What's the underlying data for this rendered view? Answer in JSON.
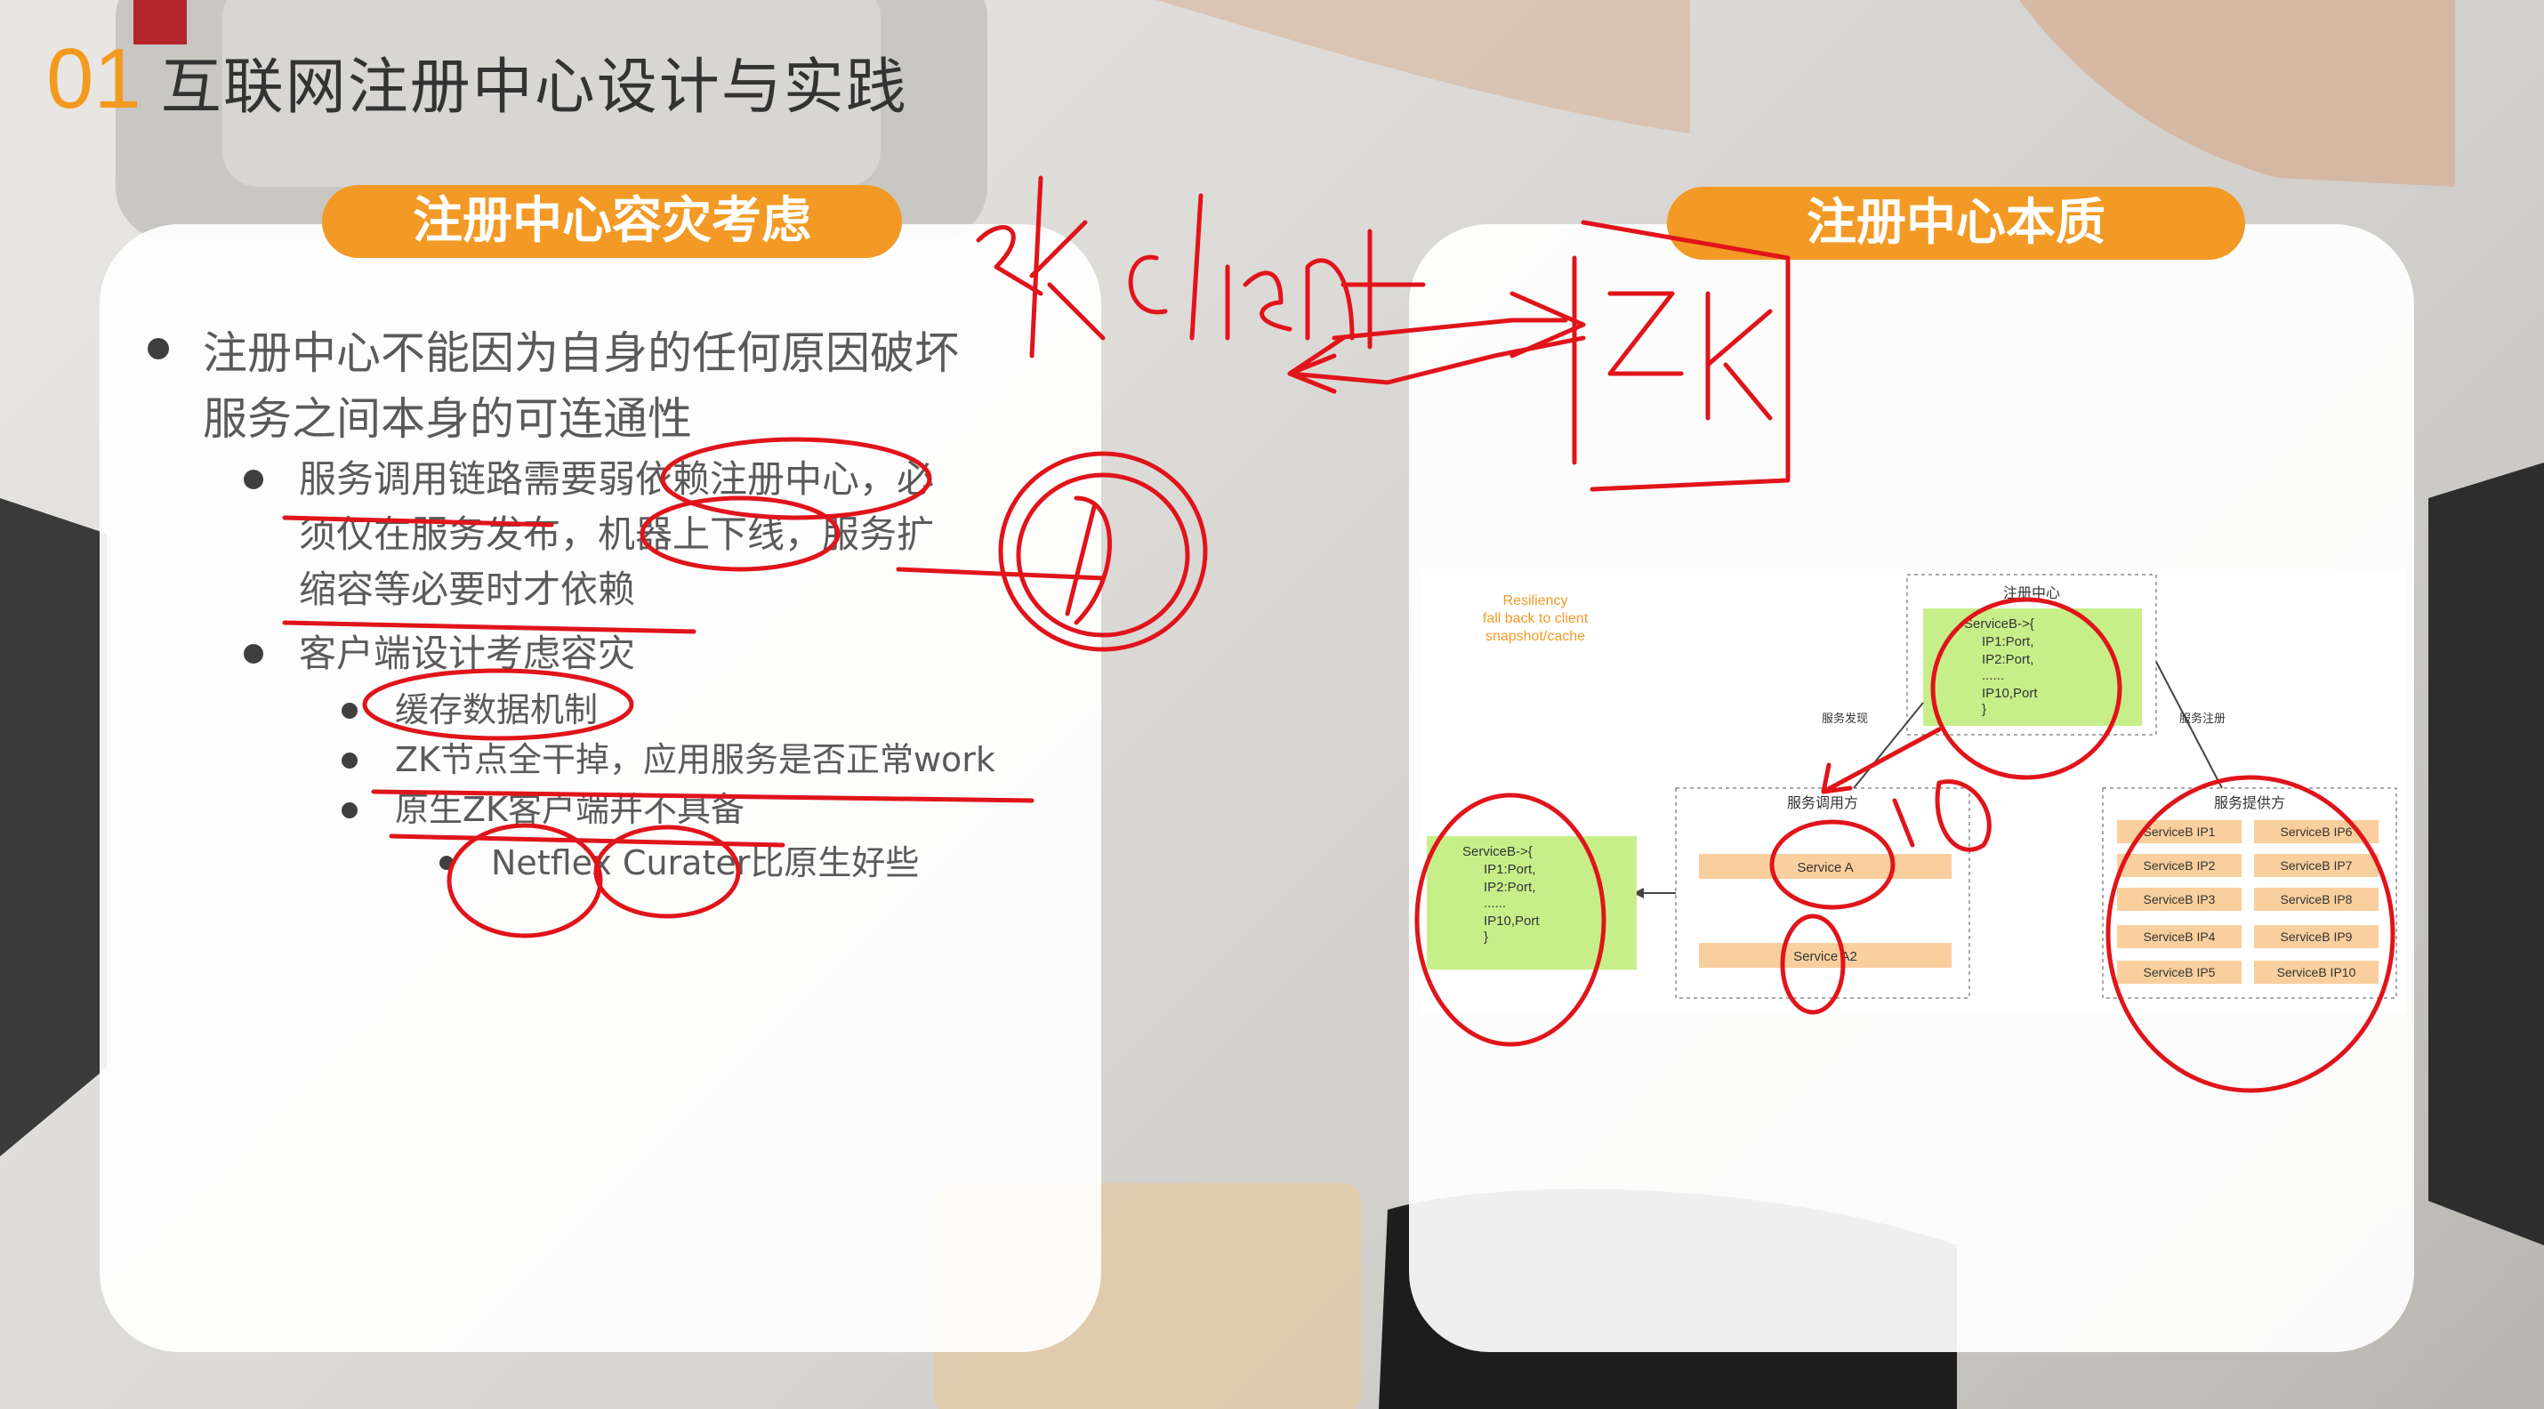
{
  "slide": {
    "number": "01",
    "title": "互联网注册中心设计与实践"
  },
  "left_panel": {
    "header": "注册中心容灾考虑",
    "bullets": [
      {
        "level": 1,
        "text": "注册中心不能因为自身的任何原因破坏",
        "text2": "服务之间本身的可连通性"
      },
      {
        "level": 2,
        "text": "服务调用链路需要弱依赖注册中心，必",
        "text2": "须仅在服务发布，机器上下线，服务扩",
        "text3": "缩容等必要时才依赖"
      },
      {
        "level": 2,
        "text": "客户端设计考虑容灾"
      },
      {
        "level": 3,
        "text": "缓存数据机制"
      },
      {
        "level": 3,
        "text": "ZK节点全干掉，应用服务是否正常work"
      },
      {
        "level": 3,
        "text": "原生ZK客户端并不具备"
      },
      {
        "level": 4,
        "text": "Netflex Curater比原生好些"
      }
    ]
  },
  "right_panel": {
    "header": "注册中心本质",
    "diagram": {
      "resiliency_note": [
        "Resiliency",
        "fall back to client",
        "snapshot/cache"
      ],
      "registry_label": "注册中心",
      "registry_entries": [
        "ServiceB->{",
        "IP1:Port,",
        "IP2:Port,",
        "......",
        "IP10,Port",
        "}"
      ],
      "cache_entries": [
        "ServiceB->{",
        "IP1:Port,",
        "IP2:Port,",
        "......",
        "IP10,Port",
        "}"
      ],
      "discover_label": "服务发现",
      "register_label": "服务注册",
      "consumer_label": "服务调用方",
      "consumer_services": [
        "Service A",
        "Service A2"
      ],
      "provider_label": "服务提供方",
      "provider_services": [
        "ServiceB IP1",
        "ServiceB IP6",
        "ServiceB IP2",
        "ServiceB IP7",
        "ServiceB IP3",
        "ServiceB IP8",
        "ServiceB IP4",
        "ServiceB IP9",
        "ServiceB IP5",
        "ServiceB IP10"
      ]
    }
  },
  "colors": {
    "accent_orange": "#f29a25",
    "ink_red": "#e0141a",
    "registry_green": "#c6ef8a",
    "service_peach": "#f9cf9e"
  }
}
